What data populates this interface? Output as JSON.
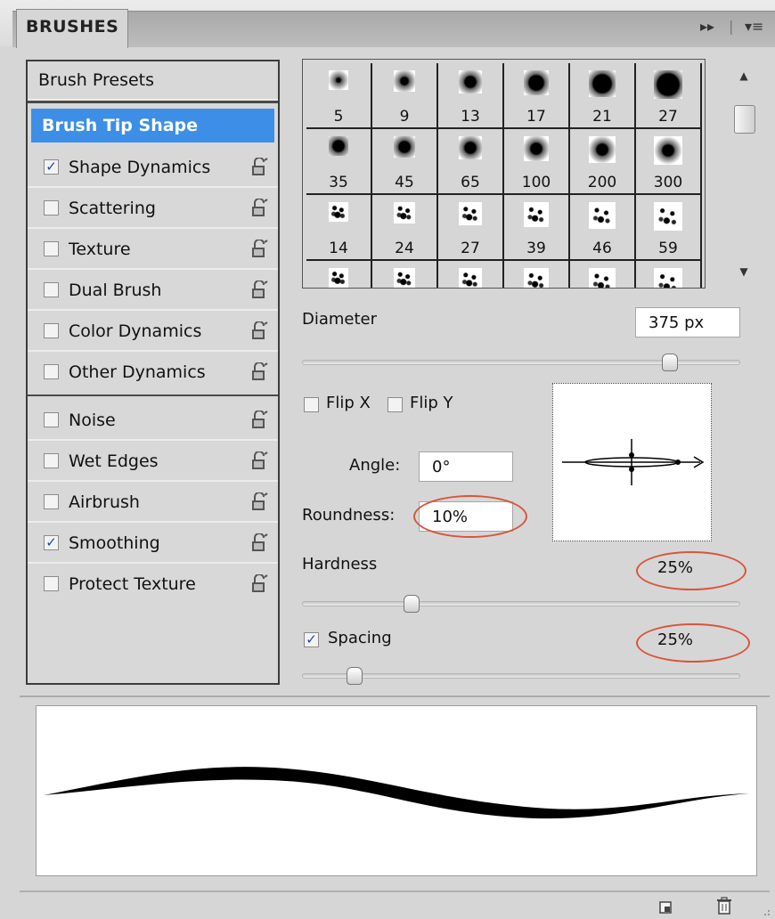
{
  "panel": {
    "tab_title": "BRUSHES",
    "tab_ctrl_collapse": "▸▸",
    "tab_ctrl_sep": "|",
    "tab_ctrl_menu": "▾≡"
  },
  "options": {
    "brush_presets": "Brush Presets",
    "brush_tip_shape": "Brush Tip Shape",
    "items": [
      {
        "label": "Shape Dynamics",
        "checked": true
      },
      {
        "label": "Scattering",
        "checked": false
      },
      {
        "label": "Texture",
        "checked": false
      },
      {
        "label": "Dual Brush",
        "checked": false
      },
      {
        "label": "Color Dynamics",
        "checked": false
      },
      {
        "label": "Other Dynamics",
        "checked": false
      },
      {
        "label": "Noise",
        "checked": false
      },
      {
        "label": "Wet Edges",
        "checked": false
      },
      {
        "label": "Airbrush",
        "checked": false
      },
      {
        "label": "Smoothing",
        "checked": true
      },
      {
        "label": "Protect Texture",
        "checked": false
      }
    ]
  },
  "presets": {
    "rows": [
      [
        "5",
        "9",
        "13",
        "17",
        "21",
        "27"
      ],
      [
        "35",
        "45",
        "65",
        "100",
        "200",
        "300"
      ],
      [
        "14",
        "24",
        "27",
        "39",
        "46",
        "59"
      ],
      [
        "",
        "",
        "",
        "",
        "",
        ""
      ]
    ],
    "scroll_up": "▲",
    "scroll_down": "▼"
  },
  "tip": {
    "diameter_label": "Diameter",
    "diameter_value": "375 px",
    "diameter_slider": 0.84,
    "flip_x": "Flip X",
    "flip_y": "Flip Y",
    "angle_label": "Angle:",
    "angle_value": "0°",
    "roundness_label": "Roundness:",
    "roundness_value": "10%",
    "hardness_label": "Hardness",
    "hardness_value": "25%",
    "hardness_slider": 0.25,
    "spacing_label": "Spacing",
    "spacing_value": "25%",
    "spacing_checked": true,
    "spacing_slider": 0.12,
    "highlight_color": "#d8553b"
  },
  "footer": {
    "new_icon": "new-brush-icon",
    "trash_icon": "trash-icon"
  }
}
